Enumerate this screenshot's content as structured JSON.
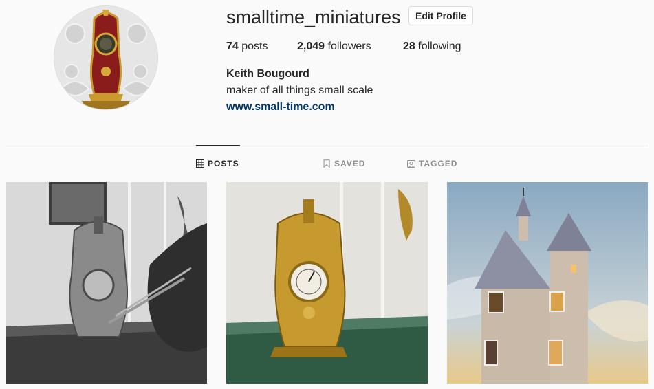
{
  "profile": {
    "username": "smalltime_miniatures",
    "edit_button_label": "Edit Profile",
    "posts_count": "74",
    "posts_label": "posts",
    "followers_count": "2,049",
    "followers_label": "followers",
    "following_count": "28",
    "following_label": "following",
    "full_name": "Keith Bougourd",
    "bio": "maker of all things small scale",
    "website": "www.small-time.com"
  },
  "tabs": [
    {
      "label": "POSTS",
      "icon": "grid-icon",
      "active": true
    },
    {
      "label": "SAVED",
      "icon": "bookmark-icon",
      "active": false
    },
    {
      "label": "TAGGED",
      "icon": "tagged-person-icon",
      "active": false
    }
  ],
  "colors": {
    "link": "#00376b",
    "divider": "#dbdbdb",
    "inactive_tab": "#8e8e8e",
    "text": "#262626"
  }
}
